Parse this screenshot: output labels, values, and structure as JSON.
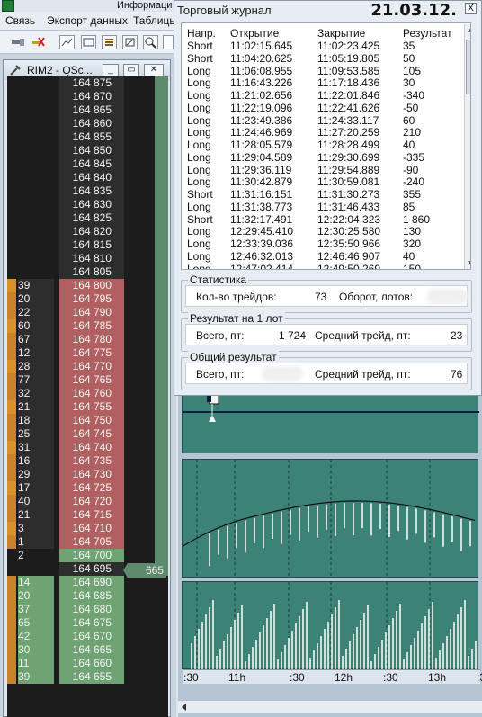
{
  "app": {
    "info_tab": "Информаци"
  },
  "menu": {
    "items": [
      "Связь",
      "Экспорт данных",
      "Таблицы"
    ]
  },
  "toolbar": {
    "icons": [
      "connect-icon",
      "disconnect-icon",
      "chart-icon",
      "window-icon",
      "list-icon",
      "settings-icon",
      "search-icon",
      "edit-icon",
      "window-split-icon"
    ]
  },
  "ladder_window": {
    "title": "RIM2 - QSc..."
  },
  "ladder": {
    "rows": [
      {
        "qty": "",
        "price": "164 875"
      },
      {
        "qty": "",
        "price": "164 870"
      },
      {
        "qty": "",
        "price": "164 865"
      },
      {
        "qty": "",
        "price": "164 860"
      },
      {
        "qty": "",
        "price": "164 855"
      },
      {
        "qty": "",
        "price": "164 850"
      },
      {
        "qty": "",
        "price": "164 845"
      },
      {
        "qty": "",
        "price": "164 840"
      },
      {
        "qty": "",
        "price": "164 835"
      },
      {
        "qty": "",
        "price": "164 830"
      },
      {
        "qty": "",
        "price": "164 825"
      },
      {
        "qty": "",
        "price": "164 820"
      },
      {
        "qty": "",
        "price": "164 815"
      },
      {
        "qty": "",
        "price": "164 810"
      },
      {
        "qty": "",
        "price": "164 805"
      },
      {
        "qty": "39",
        "price": "164 800"
      },
      {
        "qty": "20",
        "price": "164 795"
      },
      {
        "qty": "22",
        "price": "164 790"
      },
      {
        "qty": "60",
        "price": "164 785"
      },
      {
        "qty": "67",
        "price": "164 780"
      },
      {
        "qty": "12",
        "price": "164 775"
      },
      {
        "qty": "28",
        "price": "164 770"
      },
      {
        "qty": "77",
        "price": "164 765"
      },
      {
        "qty": "32",
        "price": "164 760"
      },
      {
        "qty": "21",
        "price": "164 755"
      },
      {
        "qty": "18",
        "price": "164 750"
      },
      {
        "qty": "25",
        "price": "164 745"
      },
      {
        "qty": "31",
        "price": "164 740"
      },
      {
        "qty": "16",
        "price": "164 735"
      },
      {
        "qty": "29",
        "price": "164 730"
      },
      {
        "qty": "17",
        "price": "164 725"
      },
      {
        "qty": "40",
        "price": "164 720"
      },
      {
        "qty": "21",
        "price": "164 715"
      },
      {
        "qty": "3",
        "price": "164 710"
      },
      {
        "qty": "1",
        "price": "164 705"
      },
      {
        "qty": "2",
        "price": "164 700"
      },
      {
        "qty": "",
        "price": "164 695"
      },
      {
        "qty": "14",
        "price": "164 690"
      },
      {
        "qty": "20",
        "price": "164 685"
      },
      {
        "qty": "37",
        "price": "164 680"
      },
      {
        "qty": "65",
        "price": "164 675"
      },
      {
        "qty": "42",
        "price": "164 670"
      },
      {
        "qty": "30",
        "price": "164 665"
      },
      {
        "qty": "11",
        "price": "164 660"
      },
      {
        "qty": "39",
        "price": "164 655"
      }
    ],
    "last_price_marker": "665",
    "colors": {
      "ask": "#b06060",
      "bid": "#6fa374",
      "empty": "#1c1c1c",
      "marker": "#5e8a6e"
    }
  },
  "journal": {
    "title": "Торговый журнал",
    "date": "21.03.12.",
    "close_label": "X",
    "columns": [
      "Напр.",
      "Открытие",
      "Закрытие",
      "Результат"
    ],
    "trades": [
      [
        "Short",
        "11:02:15.645",
        "11:02:23.425",
        "35"
      ],
      [
        "Short",
        "11:04:20.625",
        "11:05:19.805",
        "50"
      ],
      [
        "Long",
        "11:06:08.955",
        "11:09:53.585",
        "105"
      ],
      [
        "Long",
        "11:16:43.226",
        "11:17:18.436",
        "30"
      ],
      [
        "Long",
        "11:21:02.656",
        "11:22:01.846",
        "-340"
      ],
      [
        "Long",
        "11:22:19.096",
        "11:22:41.626",
        "-50"
      ],
      [
        "Long",
        "11:23:49.386",
        "11:24:33.117",
        "60"
      ],
      [
        "Long",
        "11:24:46.969",
        "11:27:20.259",
        "210"
      ],
      [
        "Long",
        "11:28:05.579",
        "11:28:28.499",
        "40"
      ],
      [
        "Long",
        "11:29:04.589",
        "11:29:30.699",
        "-335"
      ],
      [
        "Long",
        "11:29:36.119",
        "11:29:54.889",
        "-90"
      ],
      [
        "Long",
        "11:30:42.879",
        "11:30:59.081",
        "-240"
      ],
      [
        "Short",
        "11:31:16.151",
        "11:31:30.273",
        "355"
      ],
      [
        "Long",
        "11:31:38.773",
        "11:31:46.433",
        "85"
      ],
      [
        "Short",
        "11:32:17.491",
        "12:22:04.323",
        "1 860"
      ],
      [
        "Long",
        "12:29:45.410",
        "12:30:25.580",
        "130"
      ],
      [
        "Long",
        "12:33:39.036",
        "12:35:50.966",
        "320"
      ],
      [
        "Long",
        "12:46:32.013",
        "12:46:46.907",
        "40"
      ],
      [
        "Long",
        "12:47:02.414",
        "12:49:50.269",
        "150"
      ]
    ],
    "stats": {
      "title": "Статистика",
      "trades_label": "Кол-во трейдов:",
      "trades_value": "73",
      "turnover_label": "Оборот, лотов:"
    },
    "per_lot": {
      "title": "Результат на 1 лот",
      "total_label": "Всего, пт:",
      "total_value": "1 724",
      "avg_label": "Средний трейд, пт:",
      "avg_value": "23"
    },
    "overall": {
      "title": "Общий результат",
      "total_label": "Всего, пт:",
      "avg_label": "Средний трейд, пт:",
      "avg_value": "76"
    }
  },
  "chart": {
    "time_labels": [
      ":30",
      "11h",
      ":30",
      "12h",
      ":30",
      "13h",
      ":30"
    ],
    "colors": {
      "panel": "#3d8277",
      "line": "#111111",
      "bars": "#ffffff"
    }
  }
}
